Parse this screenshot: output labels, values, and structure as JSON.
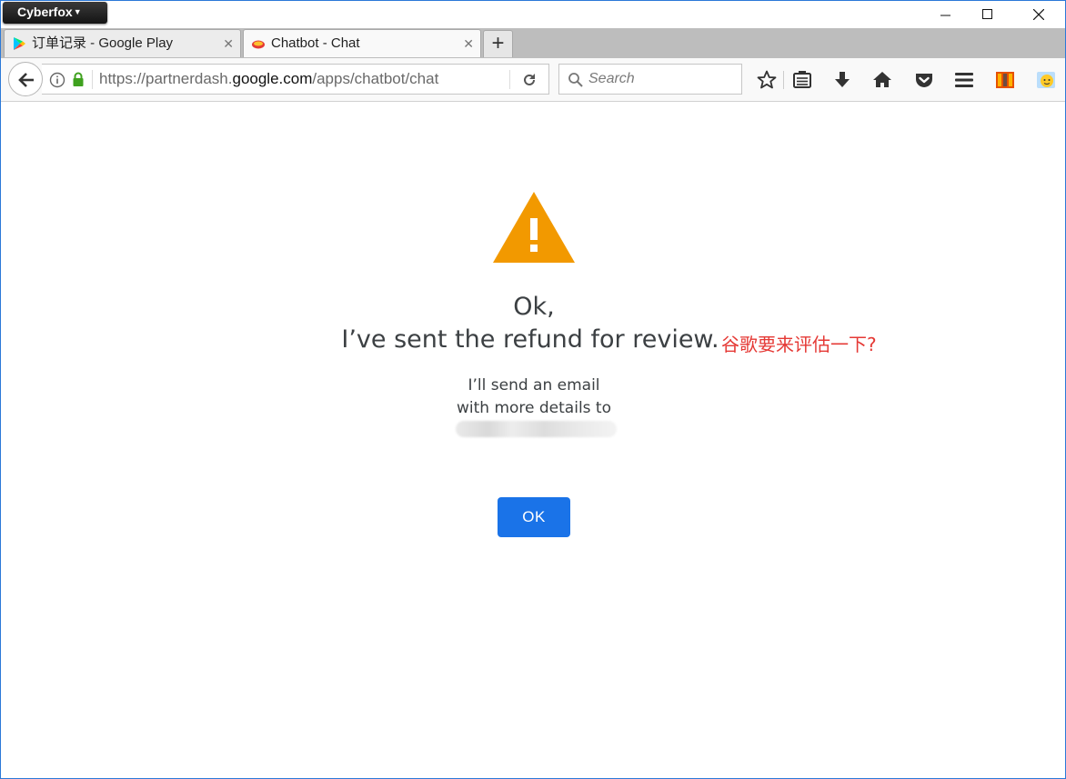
{
  "app": {
    "menu_label": "Cyberfox"
  },
  "tabs": [
    {
      "title": "订单记录 - Google Play",
      "active": false
    },
    {
      "title": "Chatbot - Chat",
      "active": true
    }
  ],
  "newtab_label": "+",
  "urlbar": {
    "url_prefix": "https://partnerdash.",
    "url_domain": "google.com",
    "url_path": "/apps/chatbot/chat"
  },
  "search": {
    "placeholder": "Search",
    "value": ""
  },
  "toolbar_icons": [
    "bookmark-star-icon",
    "reading-list-icon",
    "download-icon",
    "home-icon",
    "pocket-icon",
    "menu-icon",
    "extension-flag-icon",
    "extension-face-icon"
  ],
  "dialog": {
    "warning_color": "#f29900",
    "heading_line1": "Ok,",
    "heading_line2": "I’ve sent the refund for review.",
    "body_line1": "I’ll send an email",
    "body_line2": "with more details to",
    "ok_label": "OK",
    "ok_color": "#1a73e8"
  },
  "annotation": {
    "text": "谷歌要来评估一下?",
    "color": "#e53935"
  }
}
